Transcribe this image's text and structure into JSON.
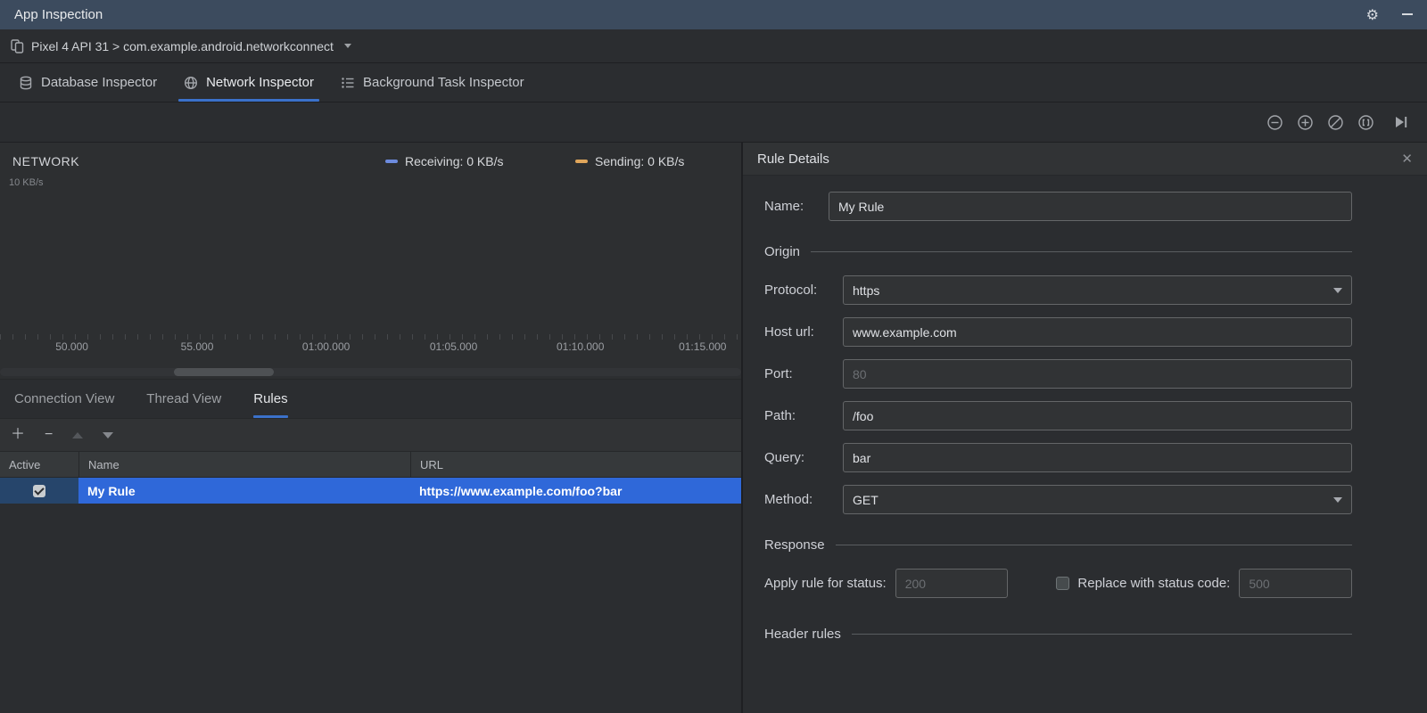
{
  "titlebar": {
    "title": "App Inspection"
  },
  "device_bar": {
    "selector": "Pixel 4 API 31 > com.example.android.networkconnect"
  },
  "inspector_tabs": {
    "database": "Database Inspector",
    "network": "Network Inspector",
    "background": "Background Task Inspector"
  },
  "colors": {
    "titlebar_bg": "#3C4B5E",
    "tab_underline": "#3B71CA",
    "row_selection": "#2F68D9",
    "receiving": "#6D8BDE",
    "sending": "#E0A65B"
  },
  "chart": {
    "title": "NETWORK",
    "y_axis_label": "10 KB/s",
    "legend": {
      "receiving": "Receiving: 0 KB/s",
      "sending": "Sending: 0 KB/s"
    },
    "timeline_ticks": [
      "50.000",
      "55.000",
      "01:00.000",
      "01:05.000",
      "01:10.000",
      "01:15.000"
    ]
  },
  "view_tabs": {
    "connection": "Connection View",
    "thread": "Thread View",
    "rules": "Rules"
  },
  "rules_table": {
    "columns": {
      "active": "Active",
      "name": "Name",
      "url": "URL"
    },
    "rows": [
      {
        "active": true,
        "name": "My Rule",
        "url": "https://www.example.com/foo?bar"
      }
    ]
  },
  "rule_details": {
    "title": "Rule Details",
    "close_glyph": "✕",
    "name_label": "Name:",
    "name_value": "My Rule",
    "origin_section": "Origin",
    "protocol_label": "Protocol:",
    "protocol_value": "https",
    "host_label": "Host url:",
    "host_value": "www.example.com",
    "port_label": "Port:",
    "port_placeholder": "80",
    "path_label": "Path:",
    "path_value": "/foo",
    "query_label": "Query:",
    "query_value": "bar",
    "method_label": "Method:",
    "method_value": "GET",
    "response_section": "Response",
    "apply_label": "Apply rule for status:",
    "apply_placeholder": "200",
    "replace_label": "Replace with status code:",
    "replace_placeholder": "500",
    "header_section": "Header rules"
  },
  "rules_toolbar": {
    "add_glyph": "＋",
    "remove_glyph": "−"
  },
  "titlebar_icons": {
    "settings_glyph": "⚙"
  }
}
